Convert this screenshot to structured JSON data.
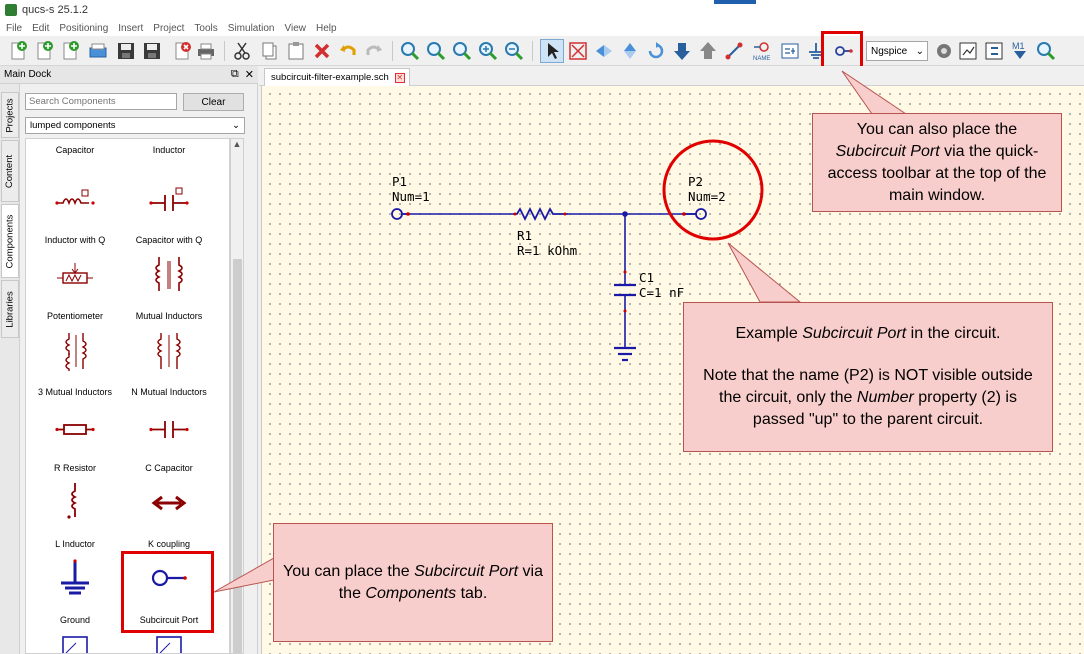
{
  "window": {
    "title": "qucs-s 25.1.2"
  },
  "menu": [
    "File",
    "Edit",
    "Positioning",
    "Insert",
    "Project",
    "Tools",
    "Simulation",
    "View",
    "Help"
  ],
  "toolbar": {
    "simulator": "Ngspice",
    "m1_label": "M1"
  },
  "dock": {
    "title": "Main Dock",
    "side_tabs": [
      "Projects",
      "Content",
      "Components",
      "Libraries"
    ],
    "search_placeholder": "Search Components",
    "clear_label": "Clear",
    "category": "lumped components",
    "components": [
      {
        "label": "Capacitor"
      },
      {
        "label": "Inductor"
      },
      {
        "label": "Inductor with Q"
      },
      {
        "label": "Capacitor with Q"
      },
      {
        "label": "Potentiometer"
      },
      {
        "label": "Mutual Inductors"
      },
      {
        "label": "3 Mutual Inductors"
      },
      {
        "label": "N Mutual Inductors"
      },
      {
        "label": "R Resistor"
      },
      {
        "label": "C Capacitor"
      },
      {
        "label": "L Inductor"
      },
      {
        "label": "K coupling"
      },
      {
        "label": "Ground"
      },
      {
        "label": "Subcircuit Port"
      }
    ]
  },
  "document": {
    "tab_name": "subcircuit-filter-example.sch"
  },
  "schematic": {
    "p1_name": "P1",
    "p1_num": "Num=1",
    "p2_name": "P2",
    "p2_num": "Num=2",
    "r1_name": "R1",
    "r1_value": "R=1 kOhm",
    "c1_name": "C1",
    "c1_value": "C=1 nF"
  },
  "callouts": {
    "toolbar": {
      "pre": "You can also place the ",
      "em": "Subcircuit Port",
      "post": " via the quick-access toolbar at the top of the main window."
    },
    "example": {
      "pre": "Example ",
      "em": "Subcircuit Port",
      "post": " in the circuit.",
      "note_pre": "Note that the name (P2) is NOT visible outside the circuit, only the ",
      "note_em": "Number",
      "note_post": " property (2) is passed \"up\" to the parent circuit."
    },
    "components": {
      "pre": "You can place the ",
      "em": "Subcircuit Port",
      "mid": " via the ",
      "em2": "Components",
      "post": " tab."
    }
  },
  "colors": {
    "wire": "#1a1aa6",
    "component": "#8b0000",
    "callout_fill": "#f8cecc",
    "callout_border": "#b85450",
    "highlight": "#e00000",
    "canvas": "#fff9e6"
  }
}
